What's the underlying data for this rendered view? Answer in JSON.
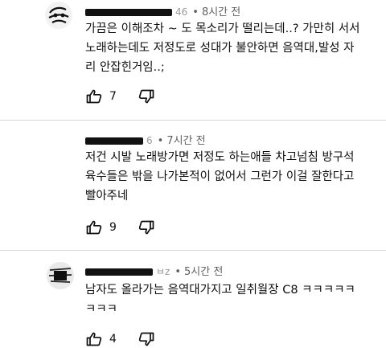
{
  "comments": [
    {
      "handle_fragment": "46",
      "time": "8시간 전",
      "text": "가끔은 이해조차 ~ 도 목소리가 떨리는데..? 가만히 서서\n노래하는데도 저정도로 성대가 불안하면 음역대,발성 자\n리 안잡힌거임..;",
      "likes": "7"
    },
    {
      "handle_fragment": "6",
      "time": "7시간 전",
      "text": "저건 시발 노래방가면 저정도 하는애들 차고넘침 방구석\n육수들은 밖을 나가본적이 없어서 그런가 이걸 잘한다고\n빨아주네",
      "likes": "9"
    },
    {
      "handle_fragment": "ㅂz",
      "time": "5시간 전",
      "text": "남자도 올라가는 음역대가지고 일취월장 C8 ㅋㅋㅋㅋㅋ\nㅋㅋㅋ",
      "likes": "4"
    }
  ],
  "dot": "•",
  "icons": {
    "like": "thumbs-up-icon",
    "dislike": "thumbs-down-icon"
  }
}
